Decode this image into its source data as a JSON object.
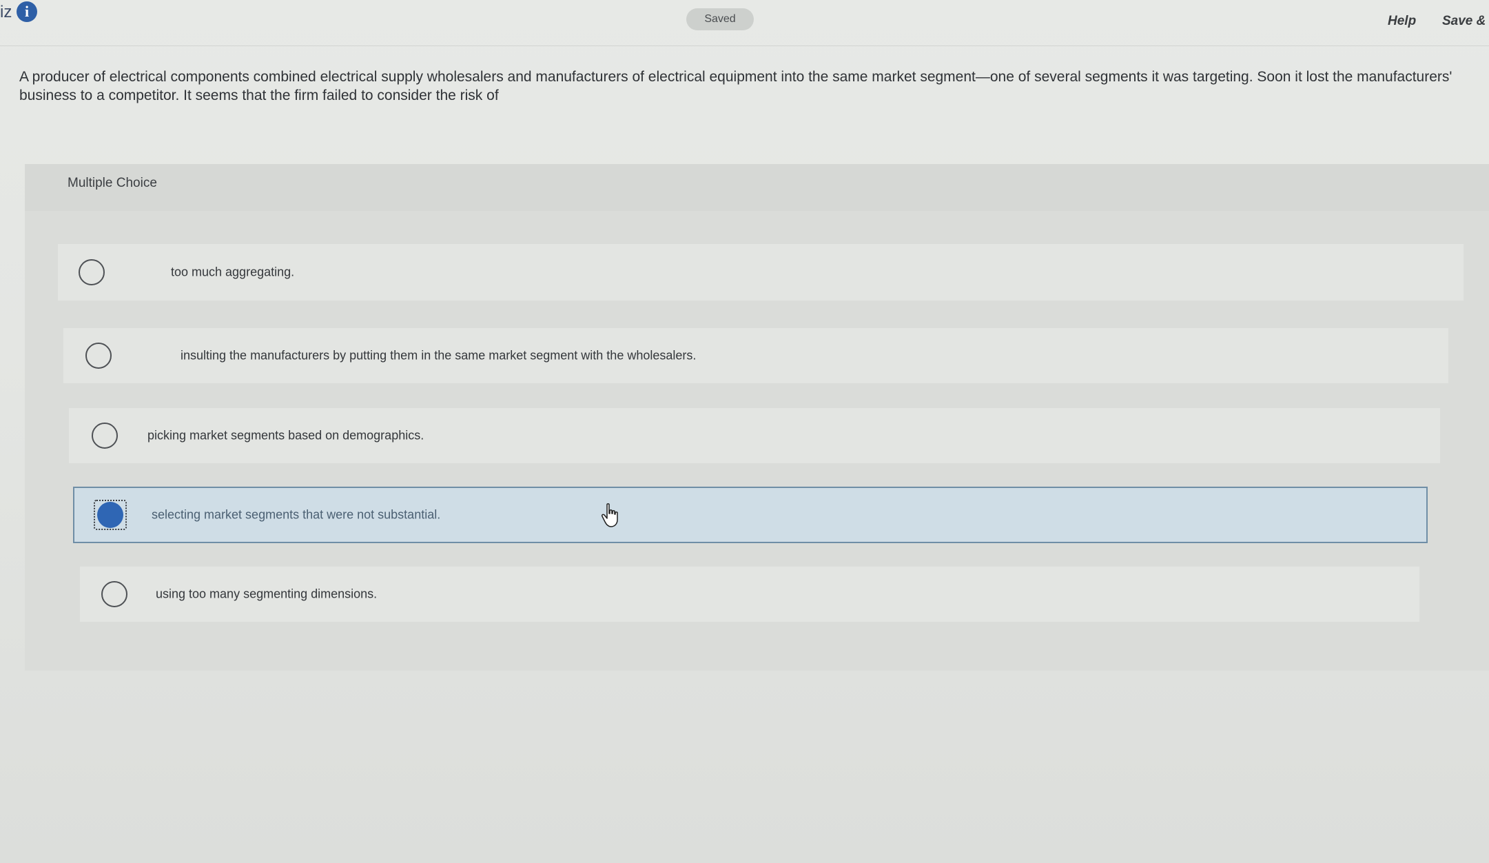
{
  "topbar": {
    "quiz_label_fragment": "iz",
    "info_icon": "info-icon",
    "status": "Saved",
    "help_label": "Help",
    "save_exit_label": "Save &"
  },
  "question": {
    "text": "A producer of electrical components combined electrical supply wholesalers and manufacturers of electrical equipment into the same market segment—one of several segments it was targeting. Soon it lost the manufacturers' business to a competitor. It seems that the firm failed to consider the risk of"
  },
  "multiple_choice": {
    "title": "Multiple Choice",
    "options": [
      {
        "label": "too much aggregating.",
        "selected": false
      },
      {
        "label": "insulting the manufacturers by putting them in the same market segment with the wholesalers.",
        "selected": false
      },
      {
        "label": "picking market segments based on demographics.",
        "selected": false
      },
      {
        "label": "selecting market segments that were not substantial.",
        "selected": true
      },
      {
        "label": "using too many segmenting dimensions.",
        "selected": false
      }
    ]
  },
  "colors": {
    "accent": "#2f66b4",
    "selected_bg": "#cfdde6"
  },
  "cursor": "hand-pointer-icon"
}
